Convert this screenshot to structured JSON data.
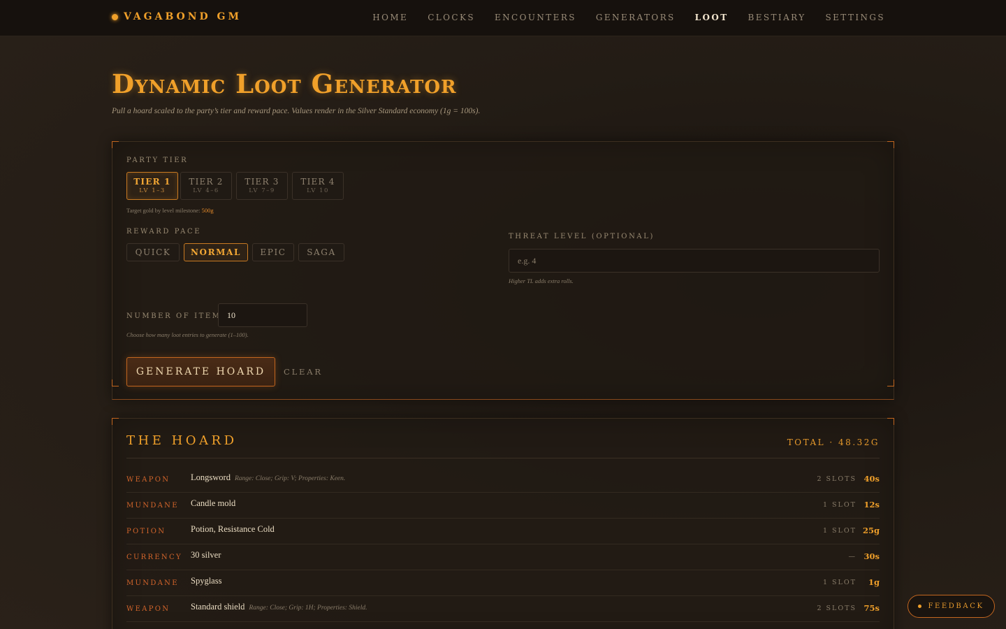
{
  "brand": "VAGABOND GM",
  "nav": [
    "HOME",
    "CLOCKS",
    "ENCOUNTERS",
    "GENERATORS",
    "LOOT",
    "BESTIARY",
    "SETTINGS"
  ],
  "active_nav": "LOOT",
  "title": "Dynamic Loot Generator",
  "subtitle": "Pull a hoard scaled to the party’s tier and reward pace. Values render in the Silver Standard economy (1g = 100s).",
  "form": {
    "party_tier_label": "PARTY TIER",
    "tiers": [
      {
        "name": "TIER 1",
        "levels": "LV 1–3"
      },
      {
        "name": "TIER 2",
        "levels": "LV 4–6"
      },
      {
        "name": "TIER 3",
        "levels": "LV 7–9"
      },
      {
        "name": "TIER 4",
        "levels": "LV 10"
      }
    ],
    "selected_tier": "TIER 1",
    "target_gold_label": "Target gold by level milestone:",
    "target_gold_value": "500g",
    "reward_pace_label": "REWARD PACE",
    "paces": [
      "QUICK",
      "NORMAL",
      "EPIC",
      "SAGA"
    ],
    "selected_pace": "NORMAL",
    "threat_label": "THREAT LEVEL (OPTIONAL)",
    "threat_placeholder": "e.g. 4",
    "threat_hint": "Higher TL adds extra rolls.",
    "items_label": "NUMBER OF ITEMS",
    "items_value": "10",
    "items_hint": "Choose how many loot entries to generate (1–100).",
    "generate_label": "GENERATE HOARD",
    "clear_label": "CLEAR"
  },
  "hoard": {
    "title": "THE HOARD",
    "total": "TOTAL · 48.32G",
    "rows": [
      {
        "category": "WEAPON",
        "name": "Longsword",
        "details": "Range: Close; Grip: V; Properties: Keen.",
        "slots": "2 SLOTS",
        "value": "40s"
      },
      {
        "category": "MUNDANE",
        "name": "Candle mold",
        "details": "",
        "slots": "1 SLOT",
        "value": "12s"
      },
      {
        "category": "POTION",
        "name": "Potion, Resistance Cold",
        "details": "",
        "slots": "1 SLOT",
        "value": "25g"
      },
      {
        "category": "CURRENCY",
        "name": "30 silver",
        "details": "",
        "slots": "—",
        "value": "30s"
      },
      {
        "category": "MUNDANE",
        "name": "Spyglass",
        "details": "",
        "slots": "1 SLOT",
        "value": "1g"
      },
      {
        "category": "WEAPON",
        "name": "Standard shield",
        "details": "Range: Close; Grip: 1H; Properties: Shield.",
        "slots": "2 SLOTS",
        "value": "75s"
      }
    ]
  },
  "feedback_label": "FEEDBACK",
  "colors": {
    "accent": "#f0a02a",
    "category": "#d3652b",
    "background": "#211a14"
  }
}
